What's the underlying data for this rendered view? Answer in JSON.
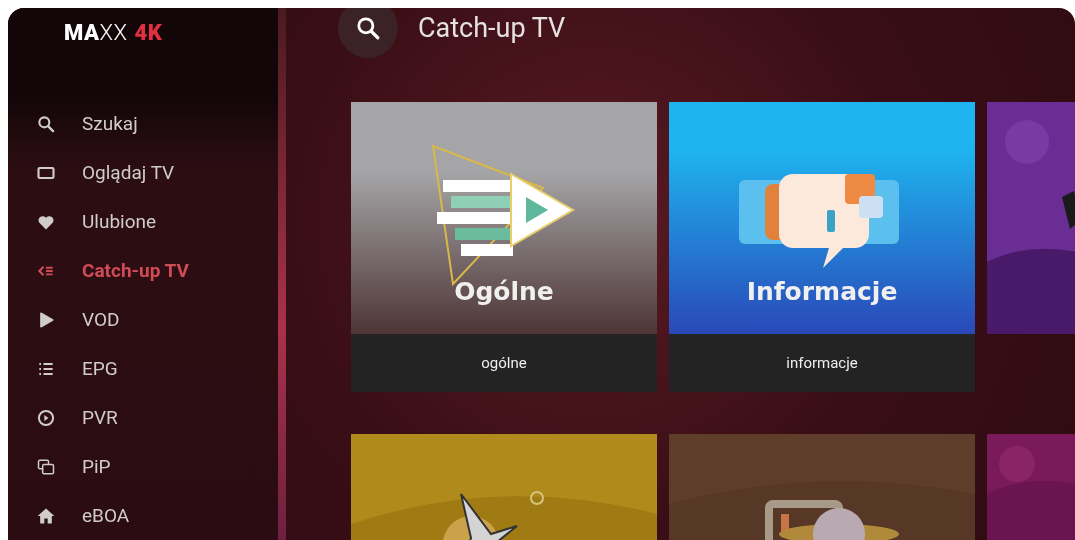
{
  "sidebar": {
    "logo": {
      "text": "**MA**XX",
      "accent": "4K"
    },
    "items": [
      {
        "label": "Szukaj",
        "selected": false
      },
      {
        "label": "Oglądaj TV",
        "selected": false
      },
      {
        "label": "Ulubione",
        "selected": false
      },
      {
        "label": "Catch-up TV",
        "selected": true
      },
      {
        "label": "VOD",
        "selected": false
      },
      {
        "label": "EPG",
        "selected": false
      },
      {
        "label": "PVR",
        "selected": false
      },
      {
        "label": "PiP",
        "selected": false
      },
      {
        "label": "eBOA",
        "selected": false
      }
    ]
  },
  "header": {
    "title": "Catch-up TV"
  },
  "rows": [
    [
      {
        "kind": "play",
        "color": "#a3a3a5",
        "tile_title": "Ogólne",
        "caption": "ogólne"
      },
      {
        "kind": "info",
        "color": "#1fa6ea",
        "tile_title": "Informacje",
        "caption": "informacje"
      },
      {
        "kind": "figure",
        "color": "#6a2d93"
      }
    ],
    [
      {
        "kind": "plane",
        "color": "#a07a12"
      },
      {
        "kind": "book",
        "color": "#573826"
      },
      {
        "kind": "plain",
        "color": "#7a1a5a"
      }
    ]
  ]
}
